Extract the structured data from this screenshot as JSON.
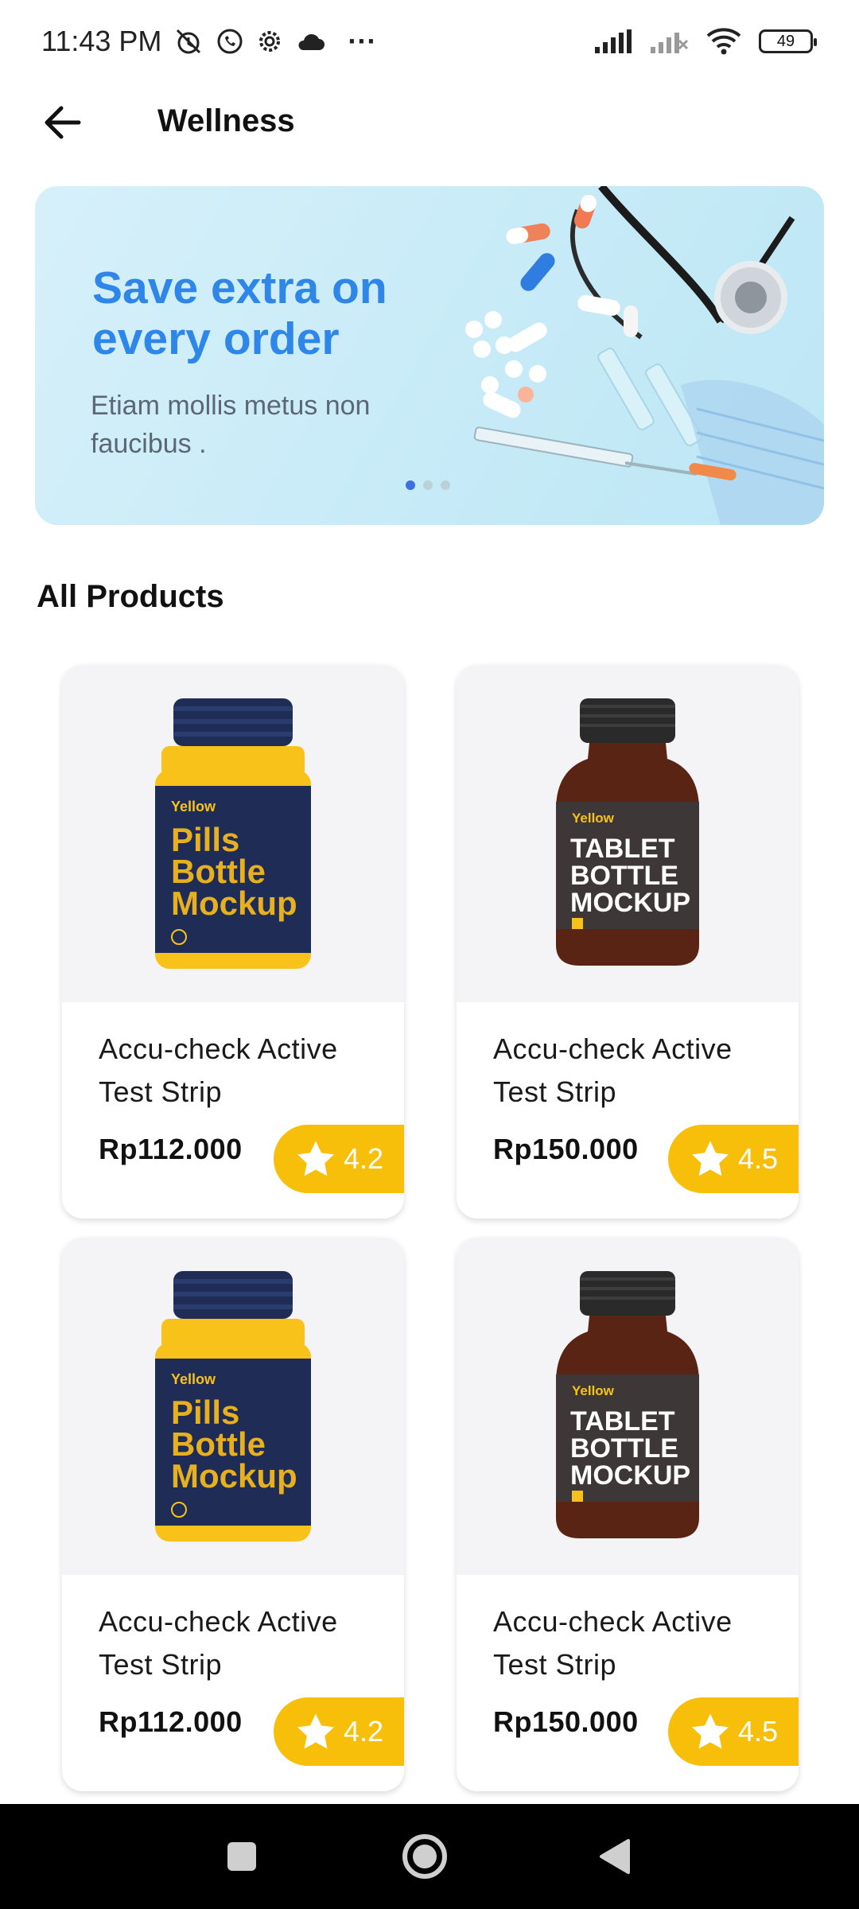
{
  "status_bar": {
    "time": "11:43 PM",
    "battery": "49",
    "more": "···"
  },
  "app_bar": {
    "title": "Wellness"
  },
  "banner": {
    "title": "Save extra on every order",
    "subtitle": "Etiam mollis metus non faucibus .",
    "slide_count": 3,
    "active_slide": 1
  },
  "section": {
    "title": "All Products"
  },
  "products": [
    {
      "name": "Accu-check Active Test Strip",
      "price": "Rp112.000",
      "rating": "4.2",
      "image": "pills-bottle-mockup",
      "label_brand": "Yellow",
      "label_text": "Pills Bottle Mockup"
    },
    {
      "name": "Accu-check Active Test Strip",
      "price": "Rp150.000",
      "rating": "4.5",
      "image": "tablet-bottle-mockup",
      "label_brand": "Yellow",
      "label_text": "TABLET BOTTLE MOCKUP"
    },
    {
      "name": "Accu-check Active Test Strip",
      "price": "Rp112.000",
      "rating": "4.2",
      "image": "pills-bottle-mockup",
      "label_brand": "Yellow",
      "label_text": "Pills Bottle Mockup"
    },
    {
      "name": "Accu-check Active Test Strip",
      "price": "Rp150.000",
      "rating": "4.5",
      "image": "tablet-bottle-mockup",
      "label_brand": "Yellow",
      "label_text": "TABLET BOTTLE MOCKUP"
    }
  ],
  "colors": {
    "accent": "#2d86e8",
    "rating_bg": "#f8bf0a",
    "card_img_bg": "#f4f4f6"
  }
}
